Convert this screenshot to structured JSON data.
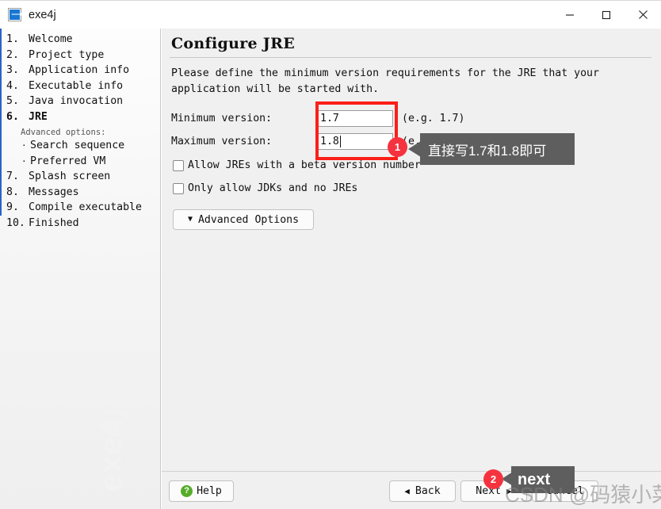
{
  "window": {
    "title": "exe4j",
    "icon": "app-icon",
    "minimize_label": "minimize",
    "maximize_label": "maximize",
    "close_label": "close"
  },
  "sidebar": {
    "watermark": "exe4j",
    "items": [
      {
        "num": "1.",
        "label": "Welcome",
        "current": false
      },
      {
        "num": "2.",
        "label": "Project type",
        "current": false
      },
      {
        "num": "3.",
        "label": "Application info",
        "current": false
      },
      {
        "num": "4.",
        "label": "Executable info",
        "current": false
      },
      {
        "num": "5.",
        "label": "Java invocation",
        "current": false
      },
      {
        "num": "6.",
        "label": "JRE",
        "current": true
      }
    ],
    "advanced_label": "Advanced options:",
    "sub_items": [
      {
        "bullet": "·",
        "label": "Search sequence"
      },
      {
        "bullet": "·",
        "label": "Preferred VM"
      }
    ],
    "items_after": [
      {
        "num": "7.",
        "label": "Splash screen",
        "current": false
      },
      {
        "num": "8.",
        "label": "Messages",
        "current": false
      },
      {
        "num": "9.",
        "label": "Compile executable",
        "current": false
      },
      {
        "num": "10.",
        "label": "Finished",
        "current": false
      }
    ]
  },
  "main": {
    "heading": "Configure JRE",
    "intro": "Please define the minimum version requirements for the JRE that your\napplication will be started with.",
    "min_version": {
      "label": "Minimum version:",
      "value": "1.7",
      "hint": "(e.g. 1.7)",
      "focused": false
    },
    "max_version": {
      "label": "Maximum version:",
      "value": "1.8",
      "hint": "(e.g. 1.8 or empty)",
      "focused": true
    },
    "checkboxes": [
      {
        "label": "Allow JREs with a beta version number",
        "checked": false
      },
      {
        "label": "Only allow JDKs and no JREs",
        "checked": false
      }
    ],
    "advanced_options_button": {
      "label": "Advanced Options",
      "caret": "▼"
    }
  },
  "footer": {
    "help": {
      "label": "Help",
      "icon": "help-question-icon",
      "icon_glyph": "?"
    },
    "back": {
      "label": "Back",
      "arrow": "◀"
    },
    "next": {
      "label": "Next",
      "arrow": "▶"
    },
    "cancel": {
      "label": "Cancel"
    }
  },
  "annotations": {
    "badge_1": "1",
    "badge_2": "2",
    "tooltip_1": "直接写1.7和1.8即可",
    "tooltip_2": "next",
    "watermark": "CSDN @码猿小菜鸡"
  },
  "colors": {
    "accent_blue": "#2a62c8",
    "highlight_red": "#fb1f19",
    "badge_red": "#f5333f",
    "tooltip_gray": "#5e5e5e",
    "help_green": "#55ac2a"
  }
}
